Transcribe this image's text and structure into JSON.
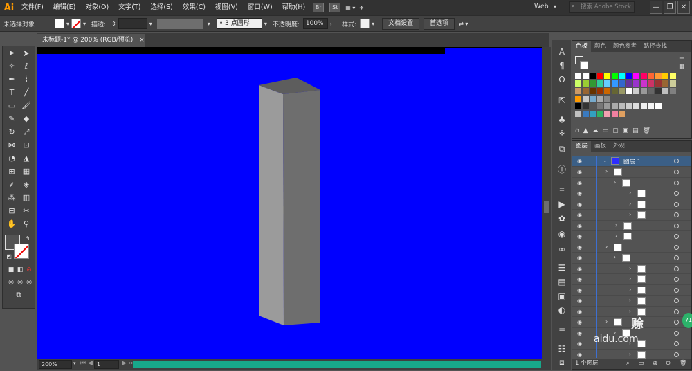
{
  "app": {
    "logo": "Ai"
  },
  "menu": {
    "items": [
      "文件(F)",
      "编辑(E)",
      "对象(O)",
      "文字(T)",
      "选择(S)",
      "效果(C)",
      "视图(V)",
      "窗口(W)",
      "帮助(H)"
    ],
    "bridge_br": "Br",
    "bridge_st": "St",
    "workspace": "Web",
    "search_placeholder": "搜索 Adobe Stock"
  },
  "control": {
    "selection": "未选择对象",
    "stroke_label": "描边:",
    "brush": "3 点圆形",
    "opacity_label": "不透明度:",
    "opacity_value": "100%",
    "style_label": "样式:",
    "doc_setup": "文档设置",
    "prefs": "首选项"
  },
  "document": {
    "tab_title": "未标题-1* @ 200% (RGB/预览)",
    "close": "×"
  },
  "status": {
    "zoom": "200%",
    "artboard": "1"
  },
  "swatch_panel": {
    "tabs": [
      "色板",
      "颜色",
      "颜色参考",
      "路径查找"
    ]
  },
  "layers_panel": {
    "tabs": [
      "图层",
      "画板",
      "外观"
    ],
    "layer_name": "图层 1",
    "sub_label": "<...",
    "footer": "1 个图层"
  },
  "colors": {
    "canvas": "#0000ff",
    "front_face": "#9b9b9b",
    "side_face": "#6e6e6e",
    "top_face": "#5d5d5d",
    "accent": "#ff9a00"
  },
  "watermark": "aidu.com"
}
